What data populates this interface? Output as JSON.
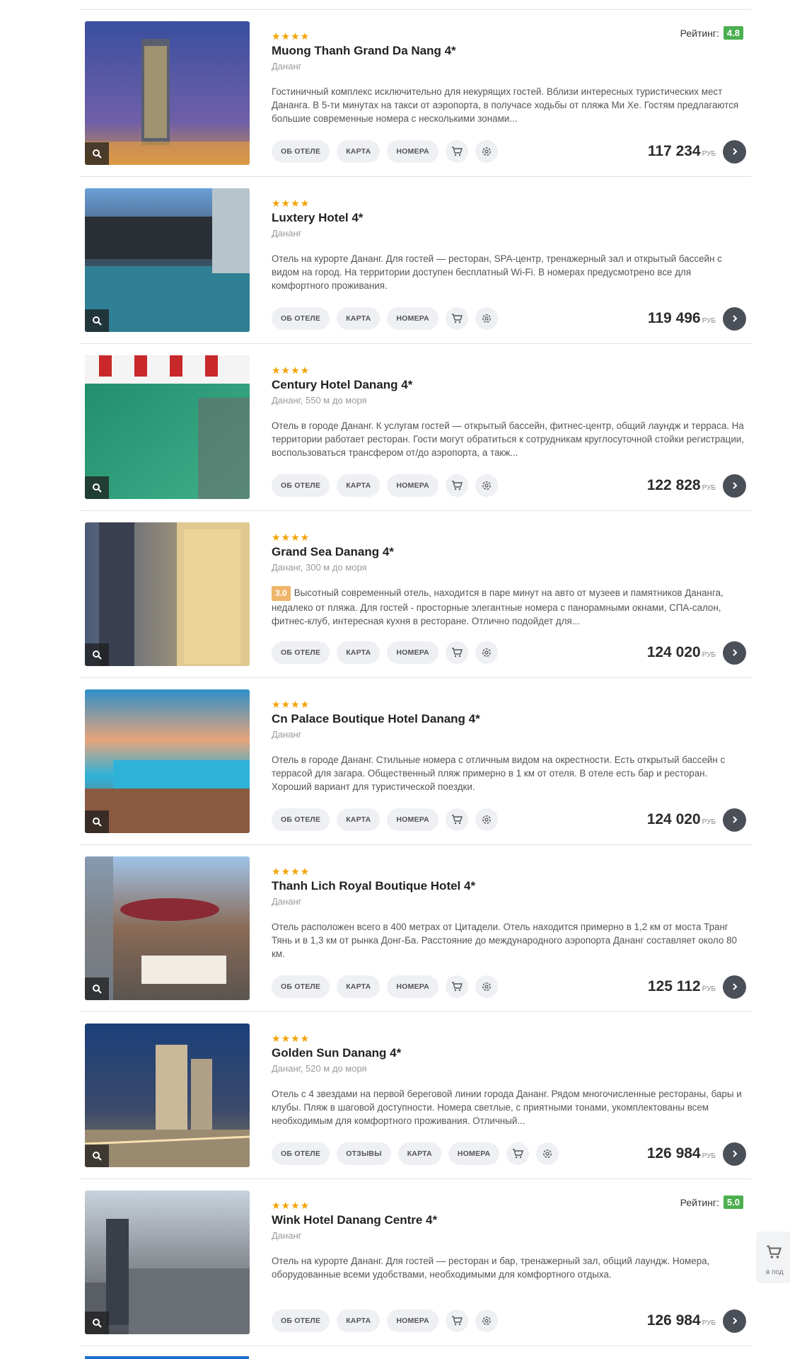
{
  "buttons": {
    "about": "ОБ ОТЕЛЕ",
    "map": "КАРТА",
    "rooms": "НОМЕРА",
    "reviews": "ОТЗЫВЫ"
  },
  "currency": "РУБ",
  "rating_label": "Рейтинг:",
  "colors": {
    "accent_dark": "#4a4f58",
    "star": "#f2a300",
    "rating_green": "#4caf50",
    "pill_bg": "#eef0f3"
  },
  "icons": [
    "search-icon",
    "cart-icon",
    "settings-icon",
    "chevron-right-icon"
  ],
  "hotels": [
    {
      "stars": "★★★★",
      "name": "Muong Thanh Grand Da Nang 4*",
      "location": "Дананг",
      "rating": "4.8",
      "desc_badge": "",
      "description": "Гостиничный комплекс исключительно для некурящих гостей. Вблизи интересных туристических мест Дананга. В 5-ти минутах на такси от аэропорта, в получасе ходьбы от пляжа Ми Хе. Гостям предлагаются большие современные номера с несколькими зонами...",
      "price": "117 234",
      "has_reviews": false
    },
    {
      "stars": "★★★★",
      "name": "Luxtery Hotel 4*",
      "location": "Дананг",
      "rating": "",
      "desc_badge": "",
      "description": "Отель на курорте Дананг. Для гостей — ресторан, SPA-центр, тренажерный зал и открытый бассейн с видом на город. На территории доступен бесплатный Wi-Fi. В номерах предусмотрено все для комфортного проживания.",
      "price": "119 496",
      "has_reviews": false
    },
    {
      "stars": "★★★★",
      "name": "Century Hotel Danang 4*",
      "location": "Дананг, 550 м до моря",
      "rating": "",
      "desc_badge": "",
      "description": "Отель в городе Дананг. К услугам гостей — открытый бассейн, фитнес-центр, общий лаундж и терраса. На территории работает ресторан. Гости могут обратиться к сотрудникам круглосуточной стойки регистрации, воспользоваться трансфером от/до аэропорта, а такж...",
      "price": "122 828",
      "has_reviews": false
    },
    {
      "stars": "★★★★",
      "name": "Grand Sea Danang 4*",
      "location": "Дананг, 300 м до моря",
      "rating": "",
      "desc_badge": "3.0",
      "description": "Высотный современный отель, находится в паре минут на авто от музеев и памятников Дананга, недалеко от пляжа. Для гостей - просторные элегантные номера с панорамными окнами, СПА-салон, фитнес-клуб, интересная кухня в ресторане. Отлично подойдет для...",
      "price": "124 020",
      "has_reviews": false
    },
    {
      "stars": "★★★★",
      "name": "Cn Palace Boutique Hotel Danang 4*",
      "location": "Дананг",
      "rating": "",
      "desc_badge": "",
      "description": "Отель в городе Дананг. Стильные номера с отличным видом на окрестности. Есть открытый бассейн с террасой для загара. Общественный пляж примерно в 1 км от отеля. В отеле есть бар и ресторан. Хороший вариант для туристической поездки.",
      "price": "124 020",
      "has_reviews": false
    },
    {
      "stars": "★★★★",
      "name": "Thanh Lich Royal Boutique Hotel 4*",
      "location": "Дананг",
      "rating": "",
      "desc_badge": "",
      "description": "Отель расположен всего в 400 метрах от Цитадели. Отель находится примерно в 1,2 км от моста Транг Тянь и в 1,3 км от рынка Донг-Ба. Расстояние до международного аэропорта Дананг составляет около 80 км.",
      "price": "125 112",
      "has_reviews": false
    },
    {
      "stars": "★★★★",
      "name": "Golden Sun Danang 4*",
      "location": "Дананг, 520 м до моря",
      "rating": "",
      "desc_badge": "",
      "description": "Отель с 4 звездами на первой береговой линии города Дананг. Рядом многочисленные рестораны, бары и клубы. Пляж в шаговой доступности. Номера светлые, с приятными тонами, укомплектованы всем необходимым для комфортного проживания. Отличный...",
      "price": "126 984",
      "has_reviews": true
    },
    {
      "stars": "★★★★",
      "name": "Wink Hotel Danang Centre 4*",
      "location": "Дананг",
      "rating": "5.0",
      "desc_badge": "",
      "description": "Отель на курорте Дананг. Для гостей — ресторан и бар, тренажерный зал, общий лаундж. Номера, оборудованные всеми удобствами, необходимыми для комфортного отдыха.",
      "price": "126 984",
      "has_reviews": false
    }
  ],
  "side_cart": {
    "label": "в под"
  }
}
